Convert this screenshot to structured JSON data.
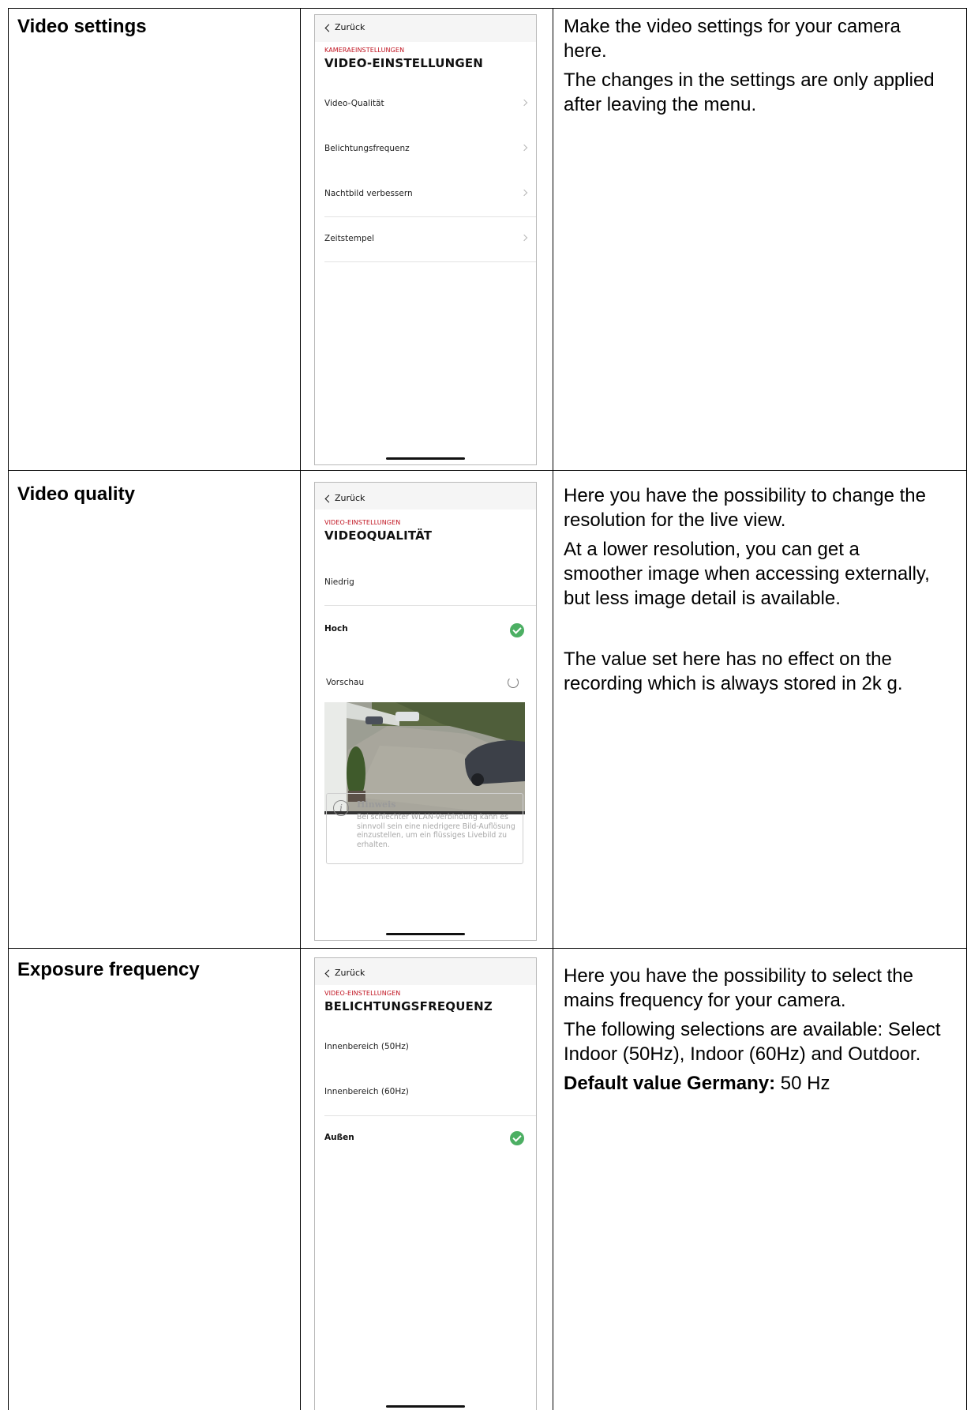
{
  "rows": [
    {
      "title": "Video settings",
      "description": [
        "Make the video settings for your camera here.",
        "The changes in the settings are only applied after leaving the menu."
      ],
      "phone": {
        "back": "Zurück",
        "breadcrumb": "KAMERAEINSTELLUNGEN",
        "title": "VIDEO-EINSTELLUNGEN",
        "items": [
          "Video-Qualität",
          "Belichtungsfrequenz",
          "Nachtbild verbessern",
          "Zeitstempel"
        ]
      }
    },
    {
      "title": "Video quality",
      "description": [
        "Here you have the possibility to change the resolution for the live view.",
        "At a lower resolution, you can get a smoother image when accessing externally, but less image detail is available.",
        "The value set here has no effect on the recording which is always stored in 2k g."
      ],
      "phone": {
        "back": "Zurück",
        "breadcrumb": "VIDEO-EINSTELLUNGEN",
        "title": "VIDEOQUALITÄT",
        "options": [
          "Niedrig",
          "Hoch"
        ],
        "selected": "Hoch",
        "preview_label": "Vorschau",
        "hint_title": "Hinweis",
        "hint_text": "Bei schlechter WLAN-Verbindung kann es sinnvoll sein eine niedrigere Bild-Auflösung einzustellen, um ein flüssiges Livebild zu erhalten."
      }
    },
    {
      "title": "Exposure frequency",
      "description": [
        "Here you have the possibility to select the mains frequency for your camera.",
        "The following selections are available: Select Indoor (50Hz), Indoor (60Hz) and Outdoor."
      ],
      "default_label": "Default value Germany:",
      "default_value": " 50 Hz",
      "phone": {
        "back": "Zurück",
        "breadcrumb": "VIDEO-EINSTELLUNGEN",
        "title": "BELICHTUNGSFREQUENZ",
        "options": [
          "Innenbereich (50Hz)",
          "Innenbereich (60Hz)",
          "Außen"
        ],
        "selected": "Außen"
      }
    }
  ],
  "colors": {
    "accent_red": "#c0121f",
    "check_green": "#4caf63"
  }
}
